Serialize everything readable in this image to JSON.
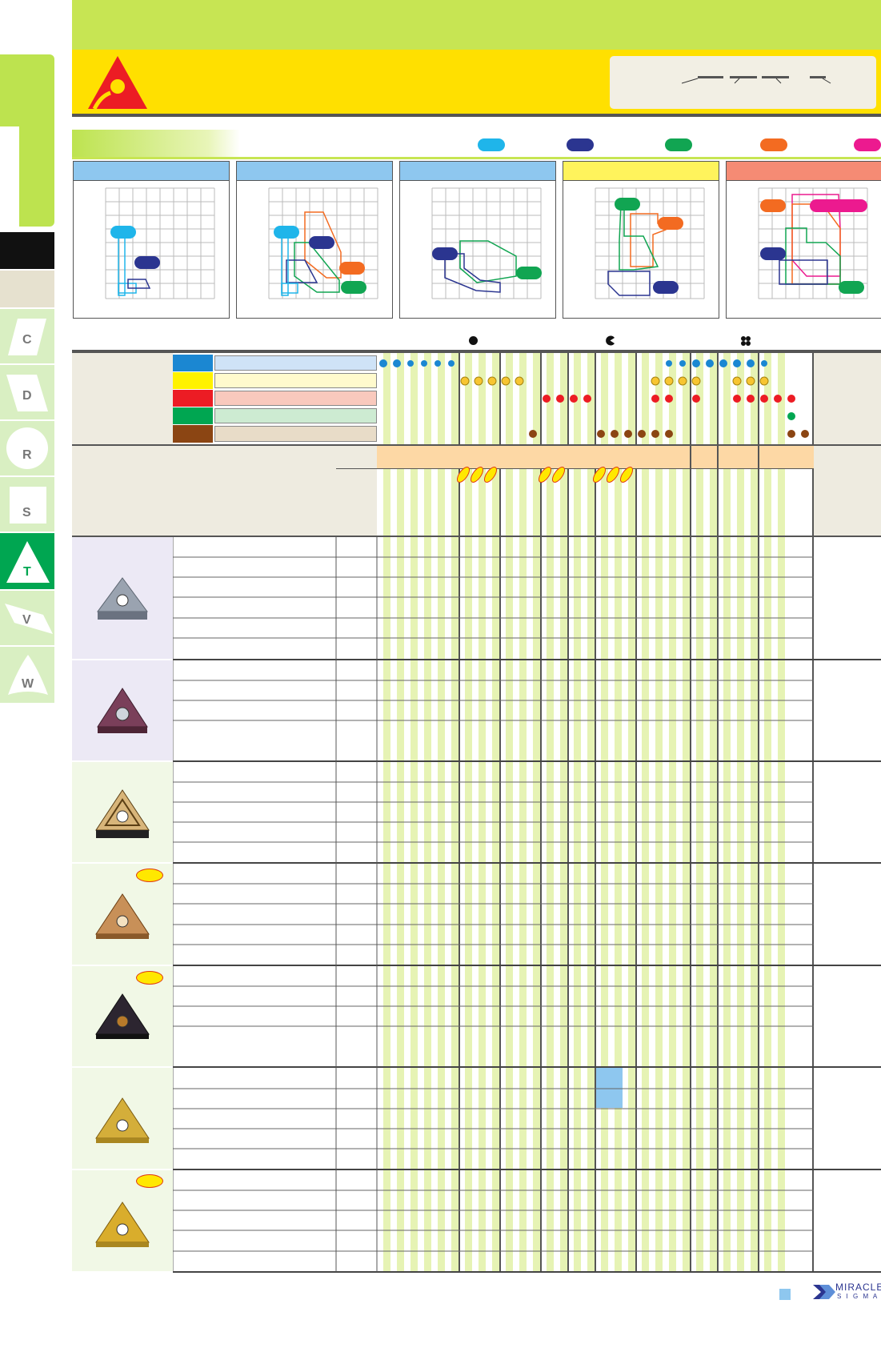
{
  "side_tabs": [
    {
      "id": "c",
      "label": "C"
    },
    {
      "id": "d",
      "label": "D"
    },
    {
      "id": "r",
      "label": "R"
    },
    {
      "id": "s",
      "label": "S"
    },
    {
      "id": "t",
      "label": "T",
      "active": true
    },
    {
      "id": "v",
      "label": "V"
    },
    {
      "id": "w",
      "label": "W"
    }
  ],
  "legend_pill_colors": [
    "#1fb5ea",
    "#2b3590",
    "#11a552",
    "#f36b21",
    "#ec1a8f"
  ],
  "material_colors": [
    "#1b87d2",
    "#fff200",
    "#ec1c24",
    "#00a651",
    "#8b4513"
  ],
  "material_band_colors": [
    "#cfe3f7",
    "#fffacd",
    "#f9c9bd",
    "#cdebd2",
    "#e8dcc8"
  ],
  "panel_header_colors": [
    "#8ec7ef",
    "#8ec7ef",
    "#8ec7ef",
    "#fff35c",
    "#f58b74"
  ],
  "row_groups": [
    {
      "name": "group-1",
      "rows": 6,
      "badge": false
    },
    {
      "name": "group-2",
      "rows": 4,
      "badge": false
    },
    {
      "name": "group-3",
      "rows": 5,
      "badge": false
    },
    {
      "name": "group-4",
      "rows": 5,
      "badge": true
    },
    {
      "name": "group-5",
      "rows": 4,
      "badge": true
    },
    {
      "name": "group-6",
      "rows": 5,
      "badge": false
    },
    {
      "name": "group-7",
      "rows": 5,
      "badge": true
    }
  ],
  "footer": {
    "brand_line1": "MIRACLE",
    "brand_line2": "S I G M A"
  }
}
